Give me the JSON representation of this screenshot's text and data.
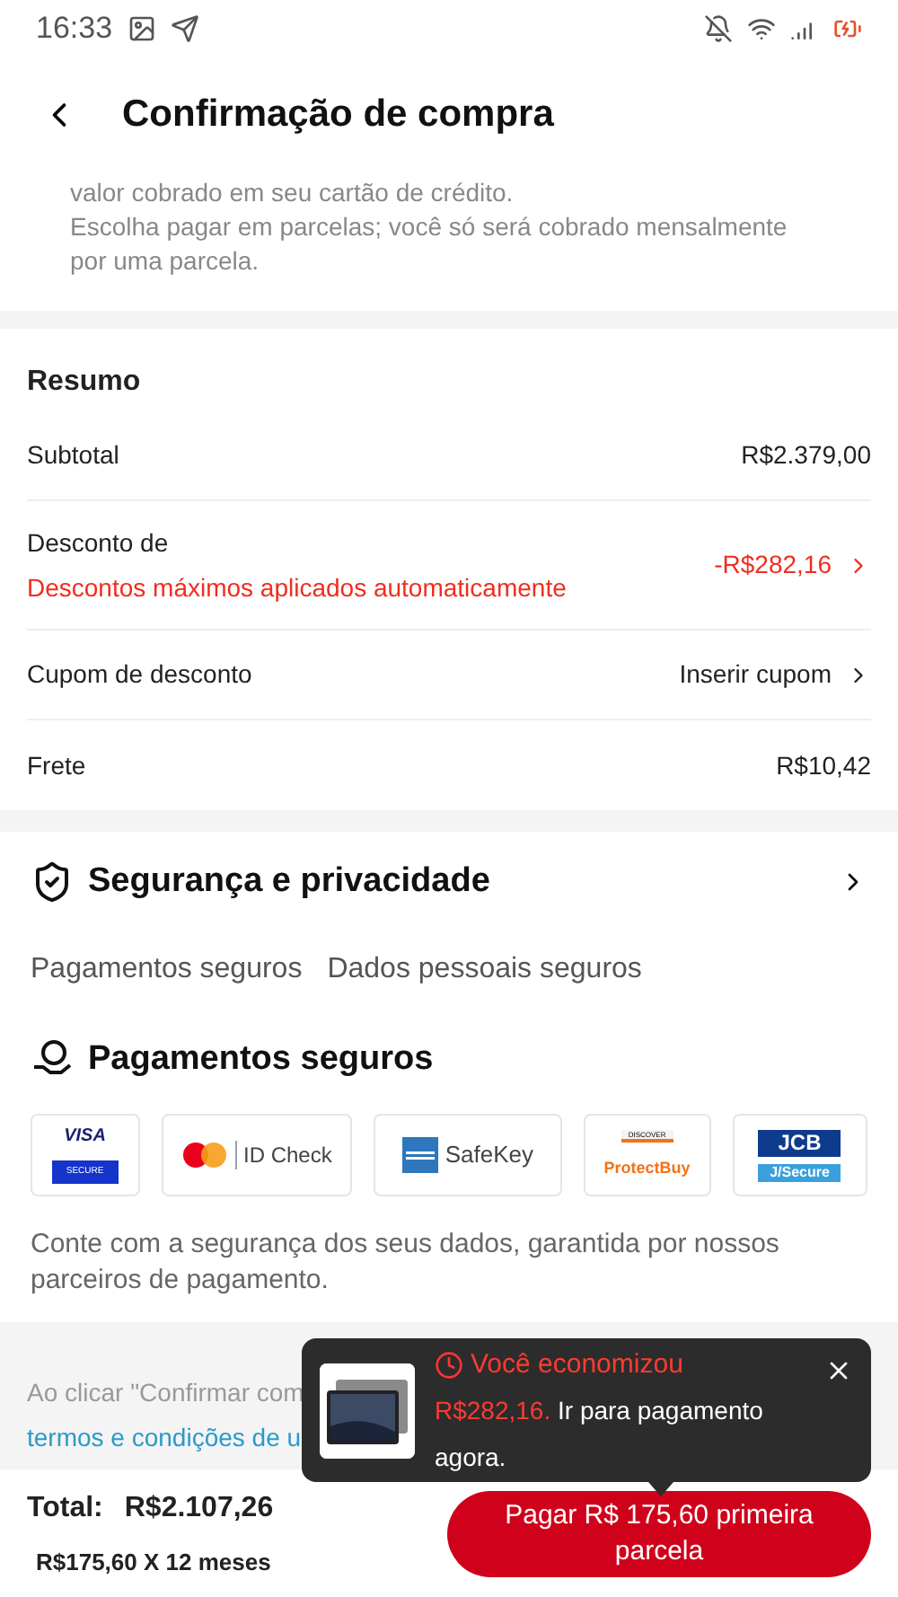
{
  "status_bar": {
    "time": "16:33"
  },
  "header": {
    "title": "Confirmação de compra"
  },
  "intro": {
    "lines": [
      "valor cobrado em seu cartão de crédito.",
      "Escolha pagar em parcelas; você só será cobrado mensalmente por uma parcela."
    ]
  },
  "summary": {
    "title": "Resumo",
    "rows": [
      {
        "kind": "plain",
        "label": "Subtotal",
        "value": "R$2.379,00"
      },
      {
        "kind": "discount",
        "label": "Desconto de",
        "sublabel": "Descontos máximos aplicados automaticamente",
        "value": "-R$282,16"
      },
      {
        "kind": "link",
        "label": "Cupom de desconto",
        "value": "Inserir cupom"
      },
      {
        "kind": "plain",
        "label": "Frete",
        "value": "R$10,42"
      }
    ]
  },
  "security": {
    "title": "Segurança e privacidade",
    "tabs": [
      {
        "label": "Pagamentos seguros"
      },
      {
        "label": "Dados pessoais seguros"
      }
    ],
    "section_title": "Pagamentos seguros",
    "badges": [
      {
        "kind": "visa",
        "texts": [
          "VISA",
          "SECURE"
        ]
      },
      {
        "kind": "mastercard",
        "texts": [
          "ID Check"
        ]
      },
      {
        "kind": "amex",
        "texts": [
          "SafeKey"
        ]
      },
      {
        "kind": "discover",
        "texts": [
          "DISCOVER",
          "ProtectBuy"
        ]
      },
      {
        "kind": "jcb",
        "texts": [
          "JCB",
          "J/Secure"
        ]
      }
    ],
    "note": "Conte com a segurança dos seus dados, garantida por nossos parceiros de pagamento."
  },
  "legal": {
    "line_1": "Ao clicar \"Confirmar com",
    "link": "termos e condições de u"
  },
  "tooltip": {
    "title": "Você economizou",
    "amount": "R$282,16.",
    "text": "Ir para pagamento agora."
  },
  "footer": {
    "total_label": "Total:",
    "total": "R$2.107,26",
    "installments": "R$175,60 X 12 meses",
    "pay_button": "Pagar R$ 175,60 primeira parcela"
  }
}
